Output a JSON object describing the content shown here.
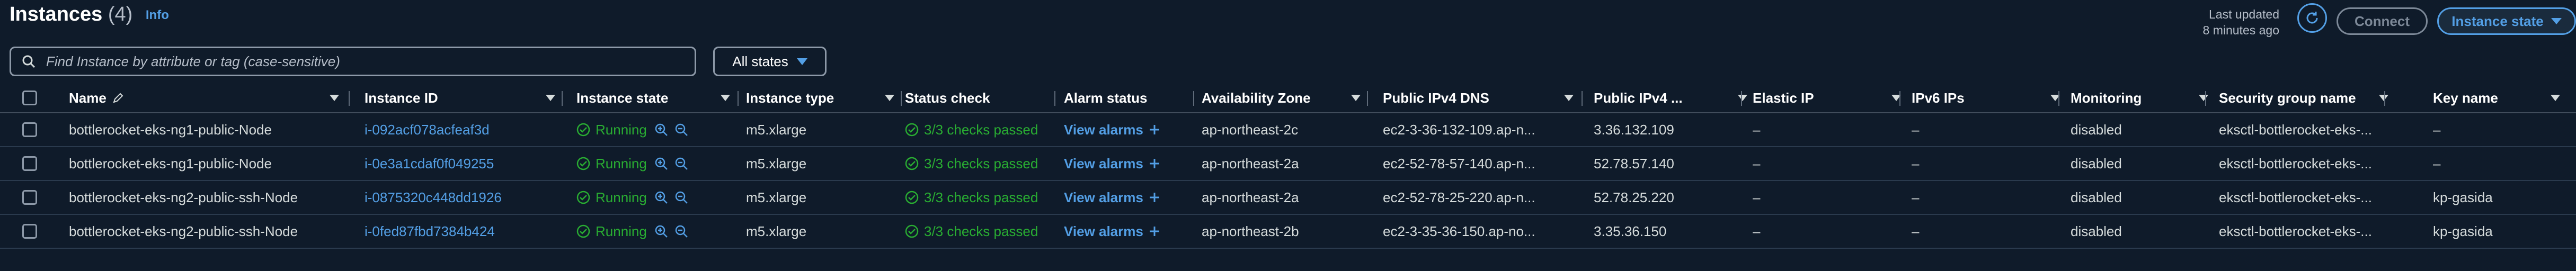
{
  "header": {
    "title": "Instances",
    "count": "(4)",
    "info": "Info",
    "last_updated_line1": "Last updated",
    "last_updated_line2": "8 minutes ago",
    "connect": "Connect",
    "instance_state": "Instance state"
  },
  "filter": {
    "search_placeholder": "Find Instance by attribute or tag (case-sensitive)",
    "states_label": "All states"
  },
  "columns": {
    "name": "Name",
    "instance_id": "Instance ID",
    "instance_state": "Instance state",
    "instance_type": "Instance type",
    "status_check": "Status check",
    "alarm_status": "Alarm status",
    "az": "Availability Zone",
    "dns": "Public IPv4 DNS",
    "ipv4": "Public IPv4 ...",
    "eip": "Elastic IP",
    "ipv6": "IPv6 IPs",
    "monitoring": "Monitoring",
    "sg": "Security group name",
    "key": "Key name"
  },
  "rows": [
    {
      "name": "bottlerocket-eks-ng1-public-Node",
      "id": "i-092acf078acfeaf3d",
      "state": "Running",
      "type": "m5.xlarge",
      "status": "3/3 checks passed",
      "alarm": "View alarms",
      "az": "ap-northeast-2c",
      "dns": "ec2-3-36-132-109.ap-n...",
      "ipv4": "3.36.132.109",
      "eip": "–",
      "ipv6": "–",
      "monitoring": "disabled",
      "sg": "eksctl-bottlerocket-eks-...",
      "key": "–"
    },
    {
      "name": "bottlerocket-eks-ng1-public-Node",
      "id": "i-0e3a1cdaf0f049255",
      "state": "Running",
      "type": "m5.xlarge",
      "status": "3/3 checks passed",
      "alarm": "View alarms",
      "az": "ap-northeast-2a",
      "dns": "ec2-52-78-57-140.ap-n...",
      "ipv4": "52.78.57.140",
      "eip": "–",
      "ipv6": "–",
      "monitoring": "disabled",
      "sg": "eksctl-bottlerocket-eks-...",
      "key": "–"
    },
    {
      "name": "bottlerocket-eks-ng2-public-ssh-Node",
      "id": "i-0875320c448dd1926",
      "state": "Running",
      "type": "m5.xlarge",
      "status": "3/3 checks passed",
      "alarm": "View alarms",
      "az": "ap-northeast-2a",
      "dns": "ec2-52-78-25-220.ap-n...",
      "ipv4": "52.78.25.220",
      "eip": "–",
      "ipv6": "–",
      "monitoring": "disabled",
      "sg": "eksctl-bottlerocket-eks-...",
      "key": "kp-gasida"
    },
    {
      "name": "bottlerocket-eks-ng2-public-ssh-Node",
      "id": "i-0fed87fbd7384b424",
      "state": "Running",
      "type": "m5.xlarge",
      "status": "3/3 checks passed",
      "alarm": "View alarms",
      "az": "ap-northeast-2b",
      "dns": "ec2-3-35-36-150.ap-no...",
      "ipv4": "3.35.36.150",
      "eip": "–",
      "ipv6": "–",
      "monitoring": "disabled",
      "sg": "eksctl-bottlerocket-eks-...",
      "key": "kp-gasida"
    }
  ],
  "colors": {
    "accent": "#539fe5",
    "success": "#29ad32",
    "background": "#0f1b2a"
  },
  "icons": [
    "edit-icon",
    "refresh-icon",
    "search-icon",
    "caret-down-icon",
    "checkmark-circle-icon",
    "zoom-in-icon",
    "zoom-out-icon",
    "plus-icon",
    "sort-caret-icon"
  ]
}
